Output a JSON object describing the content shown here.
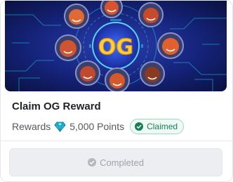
{
  "card": {
    "banner": {
      "logo_text": "OG",
      "icon": "astronaut-circle-illustration"
    },
    "title": "Claim OG Reward",
    "rewards_label": "Rewards",
    "reward_icon": "diamond-gem-icon",
    "points": "5,000 Points",
    "status_badge": "Claimed",
    "action_button": "Completed",
    "colors": {
      "badge_text": "#1a7f57",
      "badge_bg": "#eef9f4",
      "gem": "#29c2de",
      "banner_bg": "#0e1a55",
      "button_bg": "#eceef1",
      "button_text": "#9ea3aa"
    }
  }
}
